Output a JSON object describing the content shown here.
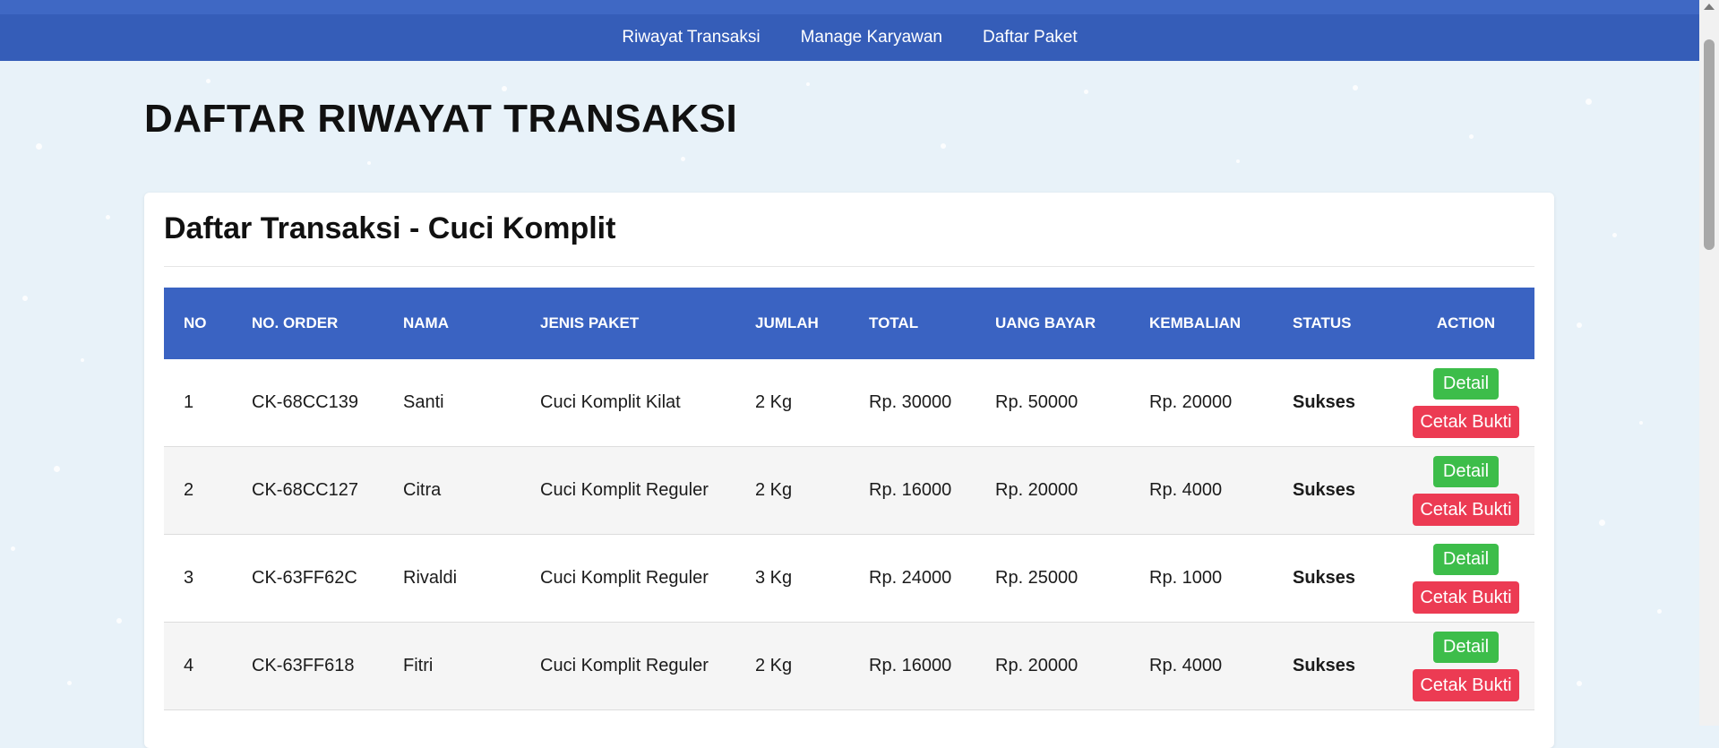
{
  "nav": {
    "links": [
      "Riwayat Transaksi",
      "Manage Karyawan",
      "Daftar Paket"
    ]
  },
  "page": {
    "title": "DAFTAR RIWAYAT TRANSAKSI"
  },
  "card": {
    "title": "Daftar Transaksi - Cuci Komplit",
    "columns": [
      "NO",
      "NO. ORDER",
      "NAMA",
      "JENIS PAKET",
      "JUMLAH",
      "TOTAL",
      "UANG BAYAR",
      "KEMBALIAN",
      "STATUS",
      "ACTION"
    ],
    "rows": [
      {
        "no": "1",
        "order": "CK-68CC139",
        "nama": "Santi",
        "paket": "Cuci Komplit Kilat",
        "jumlah": "2 Kg",
        "total": "Rp. 30000",
        "bayar": "Rp. 50000",
        "kembalian": "Rp. 20000",
        "status": "Sukses"
      },
      {
        "no": "2",
        "order": "CK-68CC127",
        "nama": "Citra",
        "paket": "Cuci Komplit Reguler",
        "jumlah": "2 Kg",
        "total": "Rp. 16000",
        "bayar": "Rp. 20000",
        "kembalian": "Rp. 4000",
        "status": "Sukses"
      },
      {
        "no": "3",
        "order": "CK-63FF62C",
        "nama": "Rivaldi",
        "paket": "Cuci Komplit Reguler",
        "jumlah": "3 Kg",
        "total": "Rp. 24000",
        "bayar": "Rp. 25000",
        "kembalian": "Rp. 1000",
        "status": "Sukses"
      },
      {
        "no": "4",
        "order": "CK-63FF618",
        "nama": "Fitri",
        "paket": "Cuci Komplit Reguler",
        "jumlah": "2 Kg",
        "total": "Rp. 16000",
        "bayar": "Rp. 20000",
        "kembalian": "Rp. 4000",
        "status": "Sukses"
      }
    ],
    "actions": {
      "detail": "Detail",
      "cetak": "Cetak Bukti"
    }
  },
  "colors": {
    "navbar": "#355db8",
    "table_header": "#3a63c2",
    "status_success": "#3cb54a",
    "button_detail": "#3dbd4a",
    "button_cetak": "#ec3b53",
    "background": "#e8f2f9"
  },
  "icons": [
    "scroll-up-arrow-icon"
  ]
}
